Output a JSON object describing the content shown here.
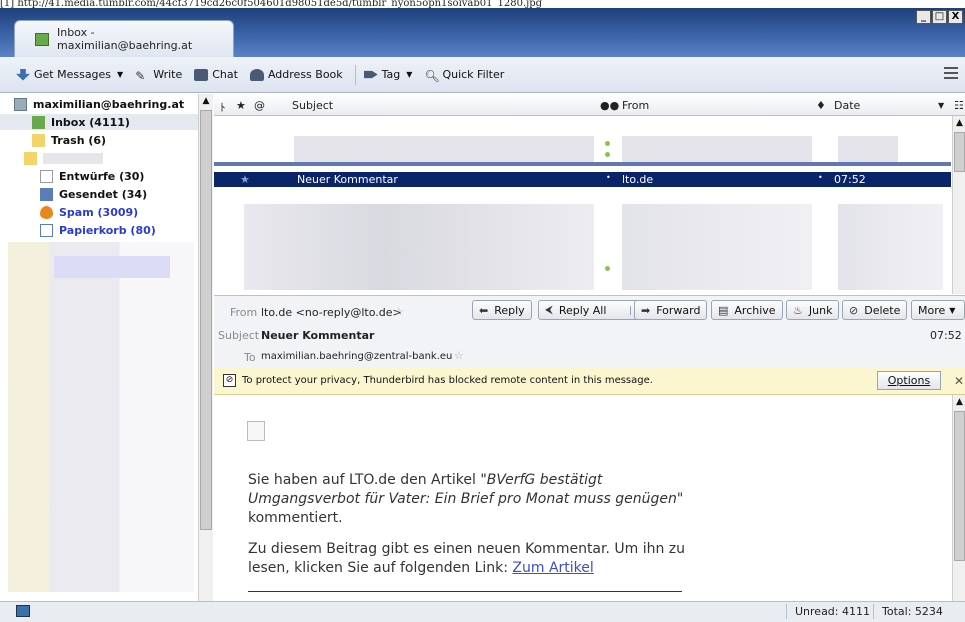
{
  "url": "[1] http://41.media.tumblr.com/44cf3719cd26c0f504601d98051de5d/tumblr_nyon5opn1soivab01_1280.jpg",
  "window": {
    "tab_title": "Inbox - maximilian@baehring.at",
    "minimize": "_",
    "maximize": "□",
    "close": "X"
  },
  "toolbar": {
    "get_messages": "Get Messages",
    "write": "Write",
    "chat": "Chat",
    "address_book": "Address Book",
    "tag": "Tag",
    "quick_filter": "Quick Filter"
  },
  "folders": {
    "account": "maximilian@baehring.at",
    "inbox": "Inbox (4111)",
    "trash": "Trash (6)",
    "drafts": "Entwürfe (30)",
    "sent": "Gesendet (34)",
    "spam": "Spam (3009)",
    "recycle": "Papierkorb (80)"
  },
  "thread_columns": {
    "subject": "Subject",
    "from": "From",
    "date": "Date"
  },
  "selected_message": {
    "subject": "Neuer Kommentar",
    "from": "lto.de",
    "date": "07:52"
  },
  "message_header": {
    "from_label": "From",
    "from_value": "lto.de <no-reply@lto.de>",
    "subject_label": "Subject",
    "subject_value": "Neuer Kommentar",
    "to_label": "To",
    "to_value": "maximilian.baehring@zentral-bank.eu",
    "time": "07:52"
  },
  "actions": {
    "reply": "Reply",
    "reply_all": "Reply All",
    "forward": "Forward",
    "archive": "Archive",
    "junk": "Junk",
    "delete": "Delete",
    "more": "More"
  },
  "notice": {
    "text": "To protect your privacy, Thunderbird has blocked remote content in this message.",
    "options": "Options"
  },
  "body": {
    "p1_a": "Sie haben auf LTO.de den Artikel ",
    "p1_title": "\"BVerfG bestätigt Umgangsverbot für Vater: Ein Brief pro Monat muss genügen\"",
    "p1_b": " kommentiert.",
    "p2_a": "Zu diesem Beitrag gibt es einen neuen Kommentar. Um ihn zu lesen, klicken Sie auf folgenden Link: ",
    "p2_link": "Zum Artikel"
  },
  "status": {
    "unread": "Unread: 4111",
    "total": "Total: 5234"
  }
}
